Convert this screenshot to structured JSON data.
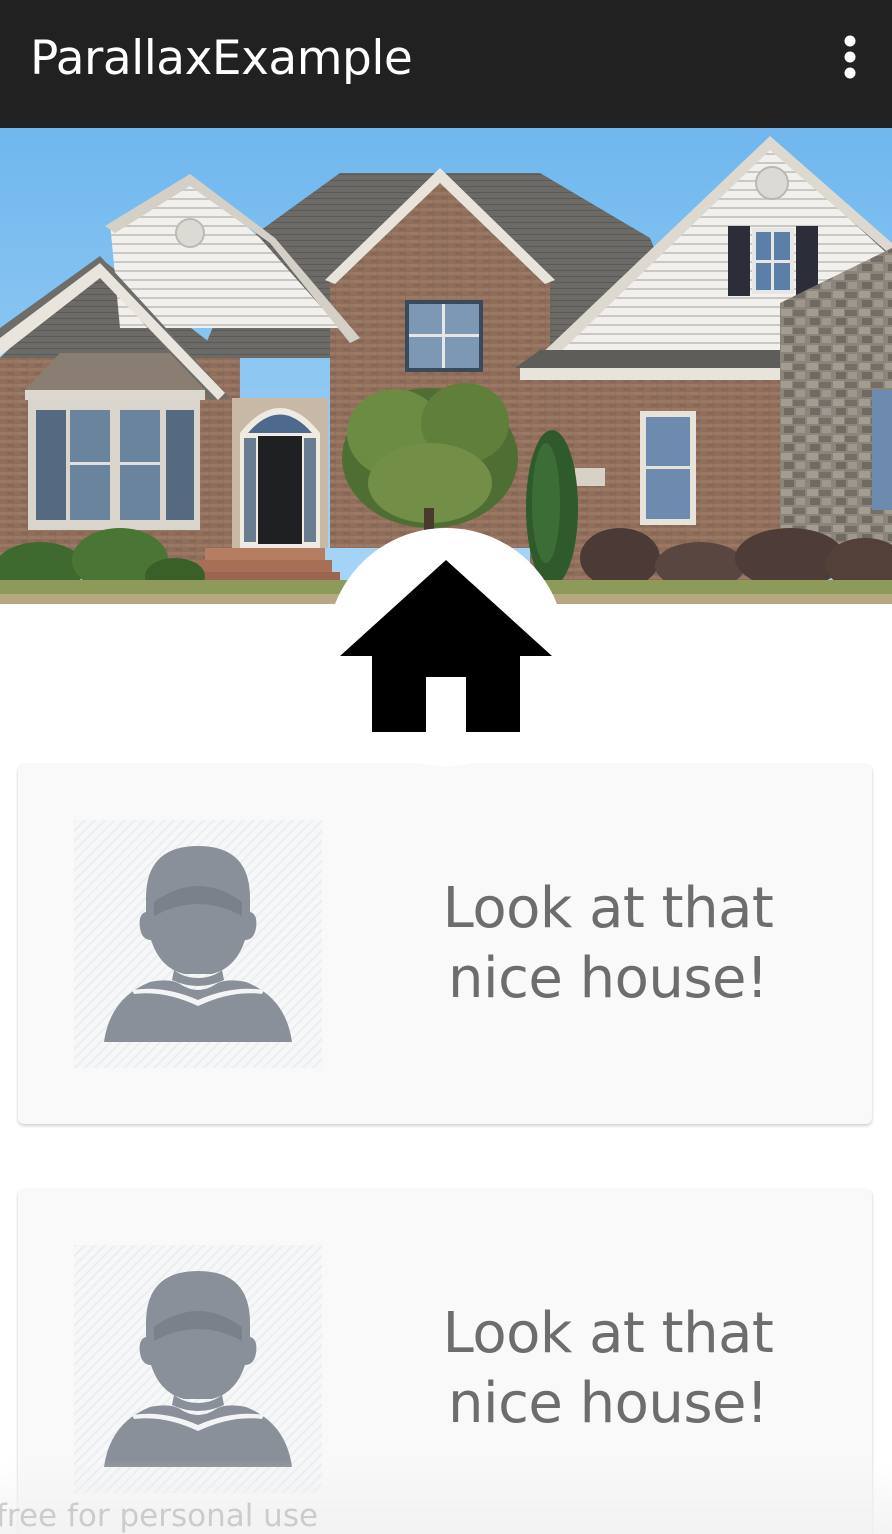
{
  "app_bar": {
    "title": "ParallaxExample",
    "overflow_icon": "more-vert-icon",
    "background": "#212121"
  },
  "header": {
    "image_subject": "house-photo",
    "badge_icon": "home-icon"
  },
  "cards": [
    {
      "avatar_icon": "person-avatar-icon",
      "text_line1": "Look at that",
      "text_line2": "nice house!"
    },
    {
      "avatar_icon": "person-avatar-icon",
      "text_line1": "Look at that",
      "text_line2": "nice house!"
    }
  ],
  "watermark": "free for personal use",
  "colors": {
    "card_bg": "#f9f9f9",
    "card_text": "#6d6d6d",
    "avatar_fg": "#8a9099"
  }
}
